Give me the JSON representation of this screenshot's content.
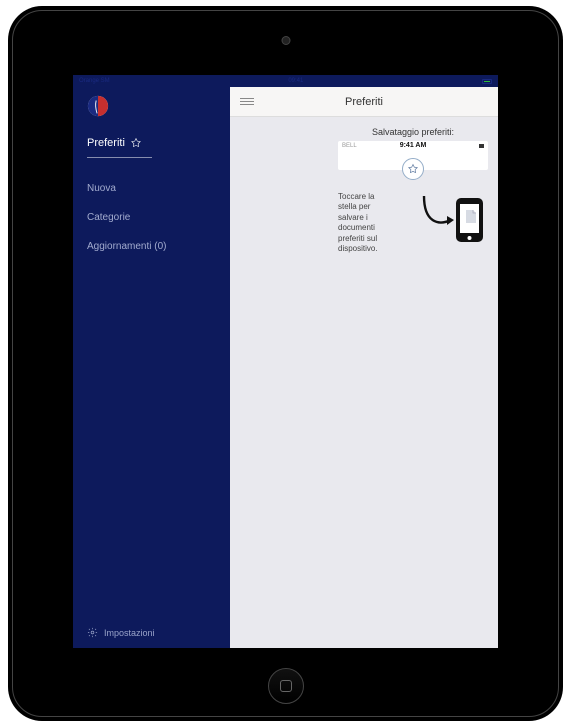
{
  "statusbar": {
    "carrier": "Orange SM",
    "time": "09:41"
  },
  "sidebar": {
    "active_label": "Preferiti",
    "items": [
      {
        "label": "Nuova"
      },
      {
        "label": "Categorie"
      },
      {
        "label": "Aggiornamenti (0)"
      }
    ],
    "settings_label": "Impostazioni"
  },
  "content": {
    "header_title": "Preferiti",
    "save_title": "Salvataggio preferiti:",
    "mock_bell": "BELL",
    "mock_time": "9:41 AM",
    "help_text": "Toccare la stella per salvare i documenti preferiti sul dispositivo."
  }
}
